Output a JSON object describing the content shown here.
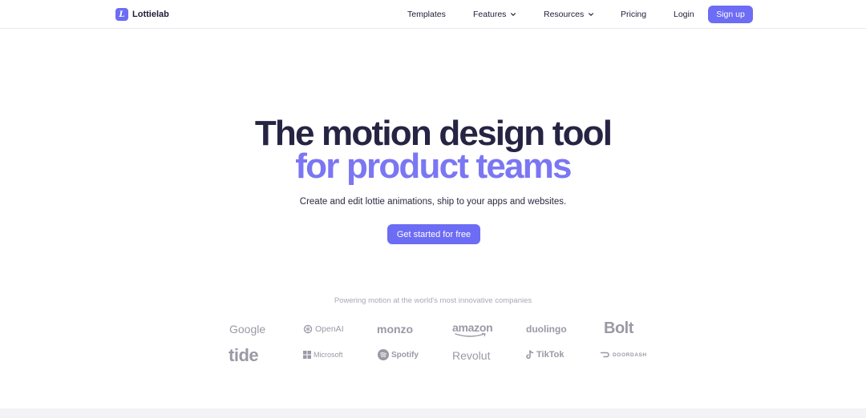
{
  "brand": {
    "logo_letter": "L",
    "name": "Lottielab"
  },
  "nav": {
    "templates": "Templates",
    "features": "Features",
    "resources": "Resources",
    "pricing": "Pricing",
    "login": "Login",
    "signup": "Sign up"
  },
  "hero": {
    "line1": "The motion design tool",
    "line2": "for product teams",
    "subtitle": "Create and edit lottie animations, ship to your apps and websites.",
    "cta": "Get started for free"
  },
  "logos": {
    "caption": "Powering motion at the world's most innovative companies",
    "row1": [
      "Google",
      "OpenAI",
      "monzo",
      "amazon",
      "duolingo",
      "Bolt"
    ],
    "row2": [
      "tide",
      "Microsoft",
      "Spotify",
      "Revolut",
      "TikTok",
      "DOORDASH"
    ]
  },
  "colors": {
    "accent": "#6c6cf5",
    "headline": "#262443",
    "headline_accent": "#7b76f3",
    "logo_gray": "#9a99a6"
  }
}
